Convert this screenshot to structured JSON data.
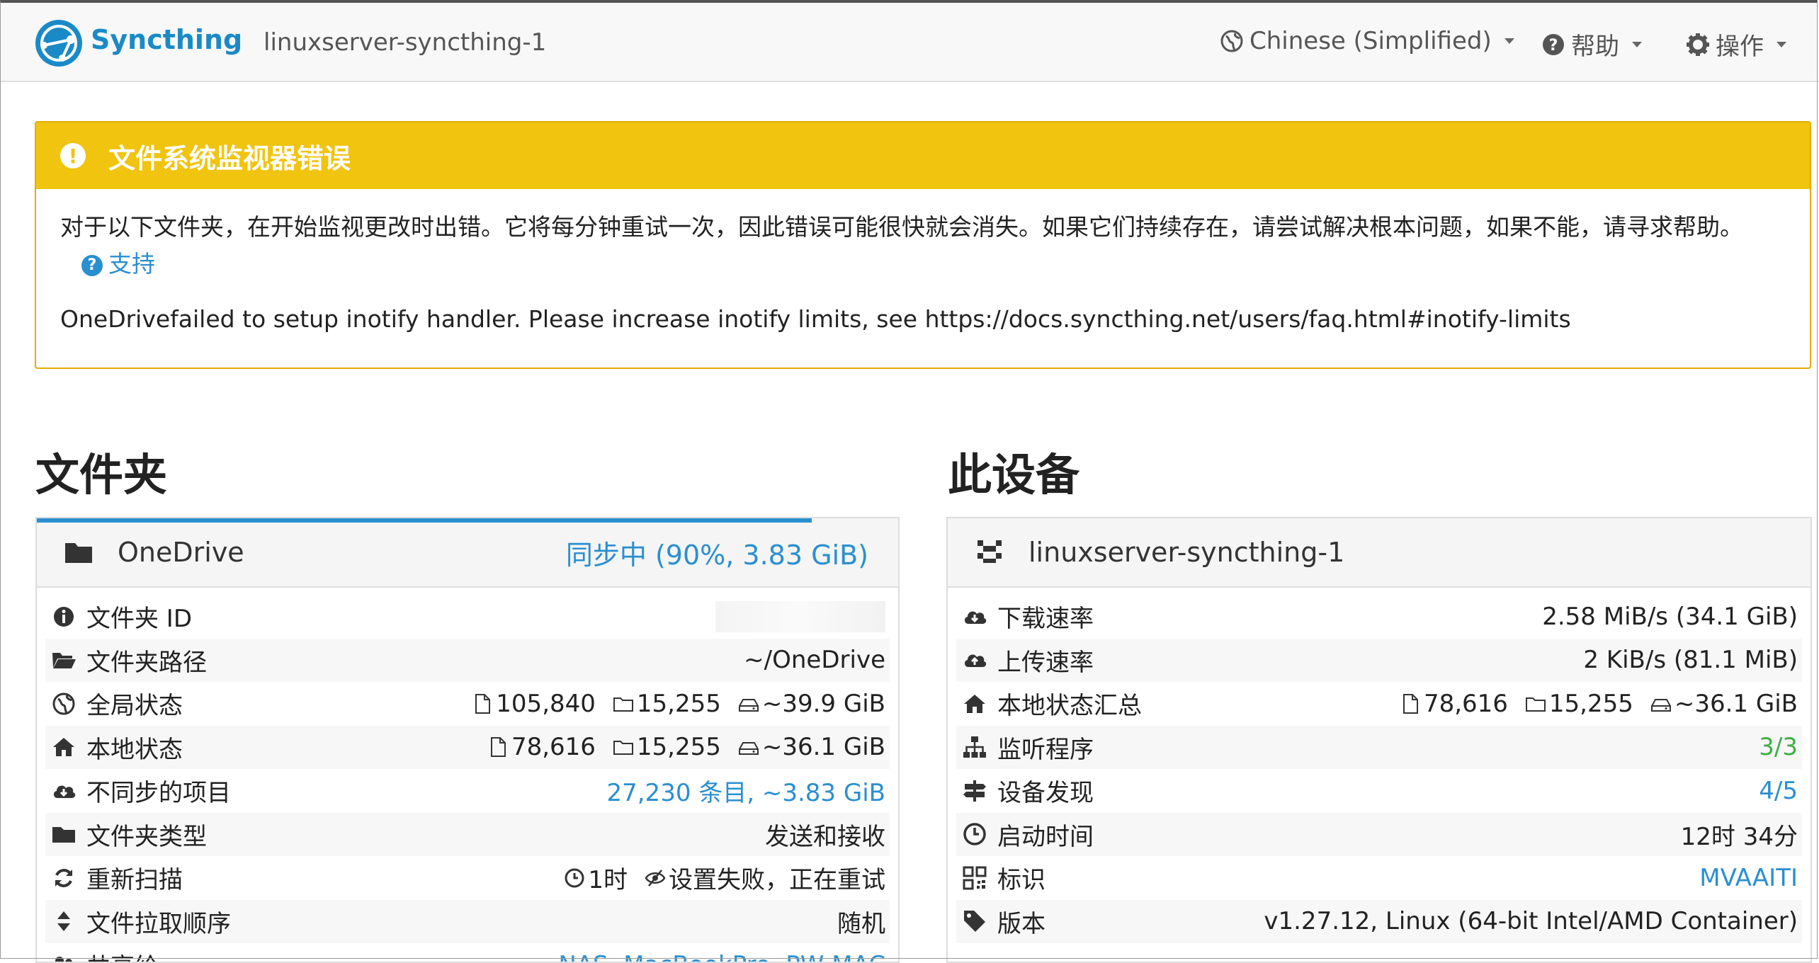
{
  "navbar": {
    "brand": "Syncthing",
    "device_name": "linuxserver-syncthing-1",
    "language": "Chinese (Simplified)",
    "help": "帮助",
    "actions": "操作"
  },
  "alert": {
    "title": "文件系统监视器错误",
    "message": "对于以下文件夹，在开始监视更改时出错。它将每分钟重试一次，因此错误可能很快就会消失。如果它们持续存在，请尝试解决根本问题，如果不能，请寻求帮助。",
    "support_link": "支持",
    "detail": "OneDrivefailed to setup inotify handler. Please increase inotify limits, see https://docs.syncthing.net/users/faq.html#inotify-limits"
  },
  "folders": {
    "section_title": "文件夹",
    "folder": {
      "name": "OneDrive",
      "status": "同步中 (90%, 3.83 GiB)",
      "progress_percent": 90,
      "rows": {
        "id_label": "文件夹 ID",
        "path_label": "文件夹路径",
        "path_value": "~/OneDrive",
        "global_label": "全局状态",
        "global_files": "105,840",
        "global_dirs": "15,255",
        "global_size": "~39.9 GiB",
        "local_label": "本地状态",
        "local_files": "78,616",
        "local_dirs": "15,255",
        "local_size": "~36.1 GiB",
        "out_of_sync_label": "不同步的项目",
        "out_of_sync_value": "27,230 条目, ~3.83 GiB",
        "type_label": "文件夹类型",
        "type_value": "发送和接收",
        "rescan_label": "重新扫描",
        "rescan_interval": "1时",
        "rescan_watch": "设置失败，正在重试",
        "pull_order_label": "文件拉取顺序",
        "pull_order_value": "随机",
        "shared_label": "共享给",
        "shared_value": "NAS, MacBookPro, PW-MAC"
      }
    }
  },
  "this_device": {
    "section_title": "此设备",
    "name": "linuxserver-syncthing-1",
    "rows": {
      "download_label": "下载速率",
      "download_value": "2.58 MiB/s (34.1 GiB)",
      "upload_label": "上传速率",
      "upload_value": "2 KiB/s (81.1 MiB)",
      "local_total_label": "本地状态汇总",
      "local_files": "78,616",
      "local_dirs": "15,255",
      "local_size": "~36.1 GiB",
      "listeners_label": "监听程序",
      "listeners_value": "3/3",
      "discovery_label": "设备发现",
      "discovery_value": "4/5",
      "uptime_label": "启动时间",
      "uptime_value": "12时 34分",
      "id_label": "标识",
      "id_value": "MVAAITI",
      "version_label": "版本",
      "version_value": "v1.27.12, Linux (64-bit Intel/AMD Container)"
    }
  },
  "colors": {
    "brand": "#1a8ac7",
    "warning": "#f0c40f",
    "link": "#2a8fd0",
    "success": "#3cb043"
  }
}
